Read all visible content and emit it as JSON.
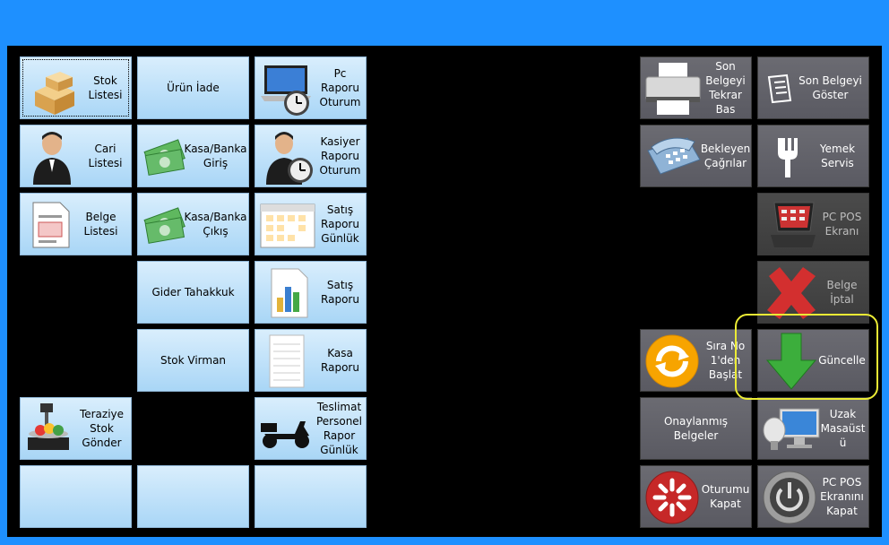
{
  "left_grid": {
    "stok_listesi": "Stok\nListesi",
    "urun_iade": "Ürün İade",
    "pc_raporu_oturum": "Pc\nRaporu\nOturum",
    "cari_listesi": "Cari\nListesi",
    "kasa_banka_giris": "Kasa/Banka\nGiriş",
    "kasiyer_raporu_oturum": "Kasiyer\nRaporu\nOturum",
    "belge_listesi": "Belge\nListesi",
    "kasa_banka_cikis": "Kasa/Banka\nÇıkış",
    "satis_raporu_gunluk": "Satış\nRaporu\nGünlük",
    "gider_tahakkuk": "Gider Tahakkuk",
    "satis_raporu": "Satış\nRaporu",
    "stok_virman": "Stok Virman",
    "kasa_raporu": "Kasa\nRaporu",
    "teraziye_stok_gonder": "Teraziye\nStok\nGönder",
    "teslimat_personel": "Teslimat\nPersonel\nRapor\nGünlük"
  },
  "right_grid": {
    "son_belgeyi_tekrar_bas": "Son\nBelgeyi\nTekrar\nBas",
    "son_belgeyi_goster": "Son Belgeyi\nGöster",
    "bekleyen_cagrilar": "Bekleyen\nÇağrılar",
    "yemek_servis": "Yemek\nServis",
    "pc_pos_ekrani": "PC POS\nEkranı",
    "belge_iptal": "Belge\nİptal",
    "sira_no": "Sıra No\n1'den\nBaşlat",
    "guncelle": "Güncelle",
    "onaylanmis_belgeler": "Onaylanmış Belgeler",
    "uzak_masaustu": "Uzak\nMasaüst\nü",
    "oturumu_kapat": "Oturumu\nKapat",
    "pc_pos_kapat": "PC POS\nEkranını\nKapat"
  }
}
